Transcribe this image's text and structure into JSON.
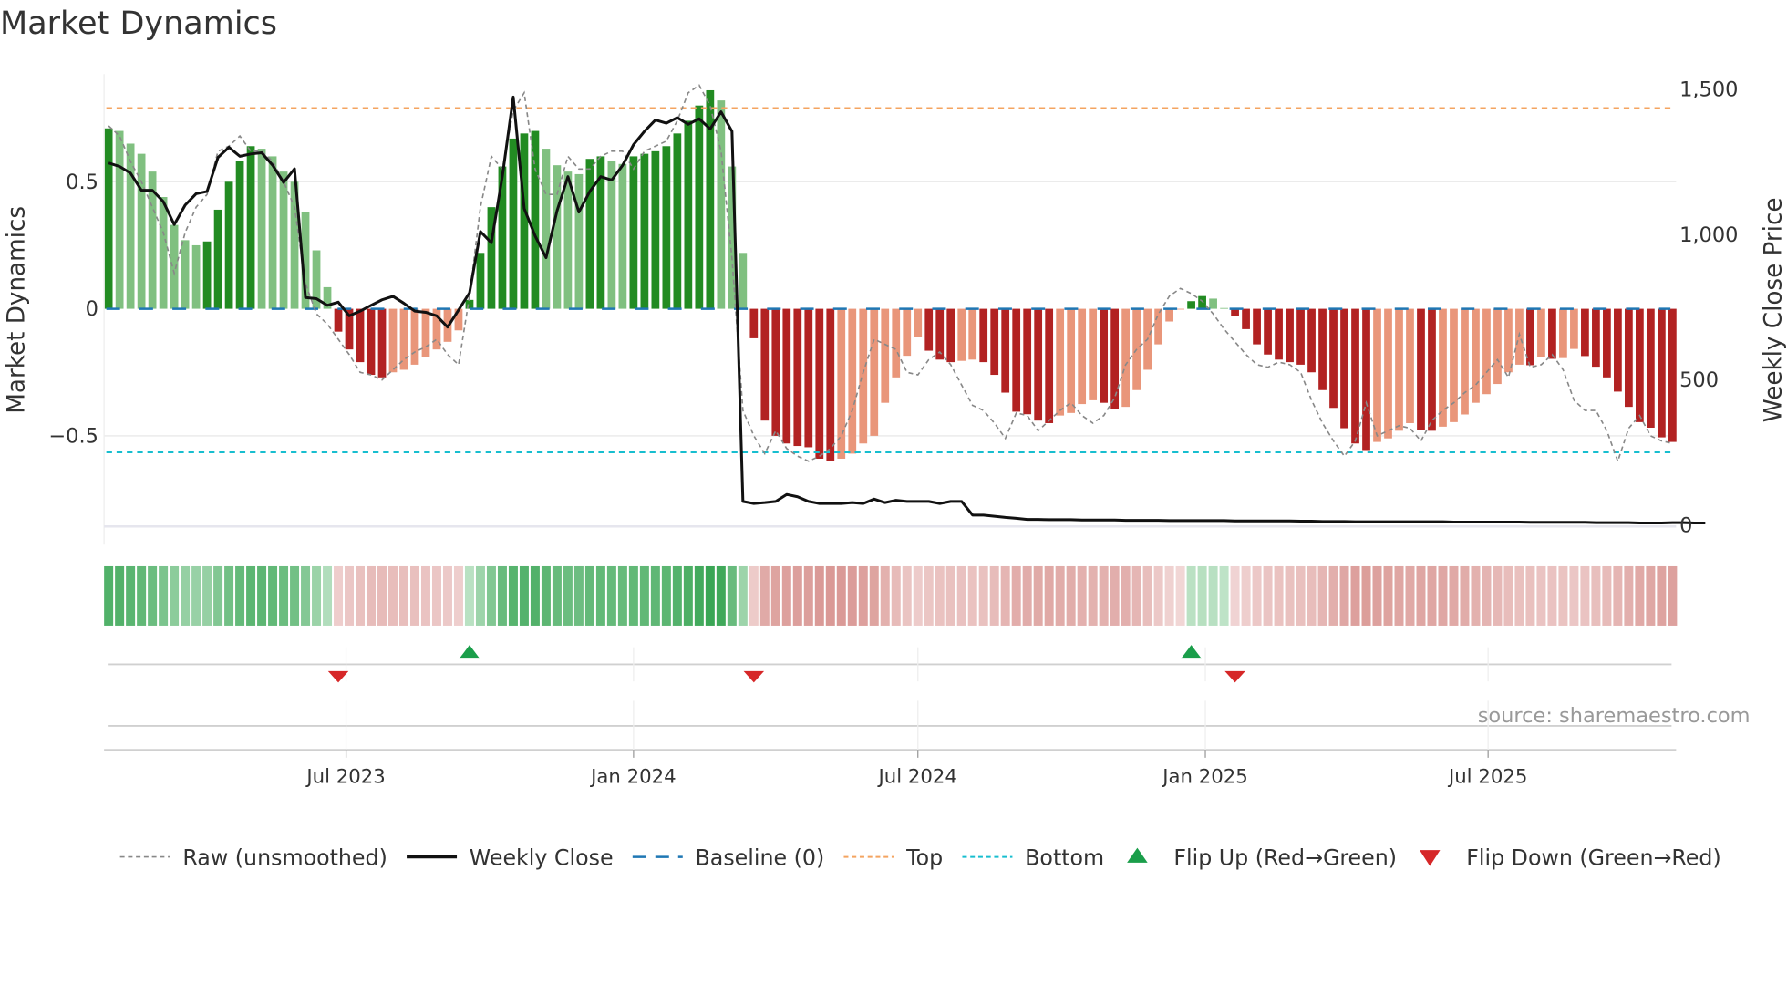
{
  "title": "Market Dynamics",
  "source": "source: sharemaestro.com",
  "chart_data": {
    "type": "bar",
    "title": "Market Dynamics",
    "ylabel": "Market Dynamics",
    "y2label": "Weekly Close Price",
    "ylim": [
      -0.85,
      0.92
    ],
    "y2lim": [
      0,
      1550
    ],
    "y_ticks": [
      {
        "value": 0.5,
        "label": "0.5"
      },
      {
        "value": 0,
        "label": "0"
      },
      {
        "value": -0.5,
        "label": "−0.5"
      }
    ],
    "y2_ticks": [
      {
        "value": 1500,
        "label": "1,500"
      },
      {
        "value": 1000,
        "label": "1,000"
      },
      {
        "value": 500,
        "label": "500"
      },
      {
        "value": 0,
        "label": "0"
      }
    ],
    "x_ticks": [
      {
        "label": "Jul 2023",
        "date": "2023-07-01"
      },
      {
        "label": "Jan 2024",
        "date": "2024-01-01"
      },
      {
        "label": "Jul 2024",
        "date": "2024-07-01"
      },
      {
        "label": "Jan 2025",
        "date": "2025-01-01"
      },
      {
        "label": "Jul 2025",
        "date": "2025-07-01"
      }
    ],
    "start_date": "2023-01-30",
    "frequency": "weekly",
    "top_level": 0.79,
    "bottom_level": -0.565,
    "baseline": 0,
    "values": [
      0.71,
      0.7,
      0.65,
      0.61,
      0.54,
      0.44,
      0.33,
      0.27,
      0.25,
      0.265,
      0.39,
      0.5,
      0.58,
      0.64,
      0.63,
      0.6,
      0.54,
      0.5,
      0.38,
      0.23,
      0.085,
      -0.09,
      -0.16,
      -0.21,
      -0.26,
      -0.27,
      -0.25,
      -0.24,
      -0.22,
      -0.19,
      -0.16,
      -0.13,
      -0.085,
      0.035,
      0.22,
      0.4,
      0.56,
      0.67,
      0.69,
      0.7,
      0.63,
      0.565,
      0.54,
      0.53,
      0.59,
      0.6,
      0.58,
      0.57,
      0.6,
      0.61,
      0.62,
      0.64,
      0.69,
      0.74,
      0.8,
      0.86,
      0.82,
      0.56,
      0.22,
      -0.116,
      -0.44,
      -0.5,
      -0.53,
      -0.54,
      -0.545,
      -0.59,
      -0.6,
      -0.59,
      -0.57,
      -0.53,
      -0.5,
      -0.37,
      -0.27,
      -0.185,
      -0.11,
      -0.165,
      -0.2,
      -0.21,
      -0.205,
      -0.2,
      -0.21,
      -0.26,
      -0.33,
      -0.405,
      -0.415,
      -0.44,
      -0.45,
      -0.42,
      -0.41,
      -0.375,
      -0.36,
      -0.37,
      -0.395,
      -0.386,
      -0.32,
      -0.24,
      -0.14,
      -0.05,
      -0.003,
      0.03,
      0.05,
      0.04,
      0.003,
      -0.03,
      -0.08,
      -0.14,
      -0.18,
      -0.2,
      -0.21,
      -0.22,
      -0.25,
      -0.32,
      -0.39,
      -0.47,
      -0.53,
      -0.556,
      -0.524,
      -0.51,
      -0.48,
      -0.45,
      -0.476,
      -0.48,
      -0.464,
      -0.446,
      -0.416,
      -0.37,
      -0.336,
      -0.296,
      -0.25,
      -0.22,
      -0.222,
      -0.19,
      -0.197,
      -0.194,
      -0.158,
      -0.186,
      -0.228,
      -0.27,
      -0.326,
      -0.386,
      -0.446,
      -0.468,
      -0.506,
      -0.524
    ],
    "raw": [
      0.72,
      0.68,
      0.58,
      0.5,
      0.4,
      0.3,
      0.14,
      0.3,
      0.4,
      0.45,
      0.62,
      0.64,
      0.68,
      0.62,
      0.62,
      0.58,
      0.5,
      0.4,
      0.1,
      -0.02,
      -0.06,
      -0.12,
      -0.18,
      -0.25,
      -0.26,
      -0.28,
      -0.24,
      -0.2,
      -0.17,
      -0.15,
      -0.12,
      -0.18,
      -0.22,
      0.05,
      0.4,
      0.6,
      0.55,
      0.78,
      0.85,
      0.55,
      0.45,
      0.45,
      0.6,
      0.55,
      0.55,
      0.6,
      0.62,
      0.62,
      0.55,
      0.62,
      0.64,
      0.66,
      0.74,
      0.85,
      0.88,
      0.8,
      0.62,
      0.2,
      -0.4,
      -0.5,
      -0.57,
      -0.48,
      -0.55,
      -0.58,
      -0.6,
      -0.58,
      -0.55,
      -0.5,
      -0.4,
      -0.25,
      -0.12,
      -0.14,
      -0.16,
      -0.25,
      -0.26,
      -0.2,
      -0.17,
      -0.22,
      -0.3,
      -0.38,
      -0.4,
      -0.45,
      -0.51,
      -0.41,
      -0.42,
      -0.48,
      -0.44,
      -0.4,
      -0.37,
      -0.42,
      -0.45,
      -0.42,
      -0.35,
      -0.22,
      -0.16,
      -0.12,
      -0.02,
      0.05,
      0.08,
      0.06,
      0.03,
      -0.02,
      -0.08,
      -0.13,
      -0.18,
      -0.22,
      -0.23,
      -0.21,
      -0.22,
      -0.25,
      -0.36,
      -0.45,
      -0.52,
      -0.58,
      -0.52,
      -0.37,
      -0.5,
      -0.48,
      -0.46,
      -0.47,
      -0.52,
      -0.44,
      -0.4,
      -0.37,
      -0.33,
      -0.3,
      -0.25,
      -0.2,
      -0.27,
      -0.1,
      -0.23,
      -0.22,
      -0.18,
      -0.24,
      -0.36,
      -0.4,
      -0.4,
      -0.48,
      -0.6,
      -0.47,
      -0.42,
      -0.5,
      -0.52,
      -0.53
    ],
    "weekly_close": [
      1247,
      1235,
      1212,
      1153,
      1153,
      1114,
      1035,
      1102,
      1141,
      1149,
      1266,
      1301,
      1270,
      1278,
      1282,
      1239,
      1180,
      1227,
      784,
      780,
      757,
      768,
      721,
      737,
      757,
      776,
      788,
      764,
      737,
      733,
      721,
      682,
      741,
      800,
      1011,
      972,
      1200,
      1474,
      1090,
      996,
      921,
      1082,
      1200,
      1078,
      1149,
      1200,
      1188,
      1239,
      1310,
      1356,
      1395,
      1384,
      1403,
      1380,
      1399,
      1364,
      1423,
      1356,
      82,
      75,
      78,
      82,
      106,
      98,
      82,
      75,
      75,
      75,
      78,
      75,
      90,
      78,
      86,
      82,
      82,
      82,
      75,
      82,
      82,
      35,
      35,
      31,
      27,
      24,
      20,
      20,
      19,
      19,
      19,
      18,
      18,
      18,
      18,
      17,
      17,
      17,
      17,
      16,
      16,
      16,
      16,
      16,
      16,
      15,
      15,
      15,
      15,
      15,
      15,
      14,
      14,
      13,
      13,
      13,
      12,
      12,
      12,
      12,
      12,
      12,
      12,
      12,
      12,
      11,
      11,
      11,
      11,
      11,
      11,
      11,
      10,
      10,
      10,
      10,
      10,
      10,
      9,
      9,
      9,
      9,
      8,
      8,
      8,
      9,
      9,
      8,
      8
    ],
    "flips": {
      "up": [
        33,
        99
      ],
      "down": [
        21,
        59,
        103
      ]
    },
    "legend": {
      "position": "bottom",
      "items": [
        {
          "label": "Raw (unsmoothed)",
          "kind": "raw"
        },
        {
          "label": "Weekly Close",
          "kind": "close"
        },
        {
          "label": "Baseline (0)",
          "kind": "baseline"
        },
        {
          "label": "Top",
          "kind": "top"
        },
        {
          "label": "Bottom",
          "kind": "bottom"
        },
        {
          "label": "Flip Up (Red→Green)",
          "kind": "up"
        },
        {
          "label": "Flip Down (Green→Red)",
          "kind": "down"
        }
      ]
    },
    "colors": {
      "pos_rising": "#228b22",
      "pos_falling": "#80c080",
      "neg_falling": "#b22222",
      "neg_rising": "#e9967a",
      "raw": "#888888",
      "close": "#111111",
      "baseline": "#1f77b4",
      "top": "#f4a460",
      "bottom": "#17becf",
      "flip_up": "#1a9e4a",
      "flip_down": "#d62728",
      "heat_pos": "#3aa655",
      "heat_neg": "#d07f7a"
    }
  }
}
